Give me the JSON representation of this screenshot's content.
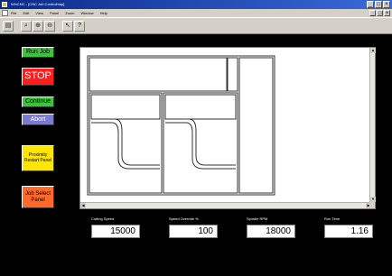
{
  "window": {
    "title": "WinCNC - [CNC Job Controlmap]",
    "controls": [
      "_",
      "□",
      "×"
    ]
  },
  "menubar": {
    "items": [
      "File",
      "Edit",
      "View",
      "Panel",
      "Zoom",
      "Window",
      "Help"
    ]
  },
  "toolbar": {
    "icons": [
      "open-icon",
      "zoom-icon",
      "zoom-in-icon",
      "zoom-out-icon",
      "pointer-icon",
      "help-icon"
    ],
    "glyphs": [
      "▤",
      "⌕",
      "⊕",
      "⊖",
      "↖",
      "?"
    ]
  },
  "buttons": {
    "run_job": "Run Job",
    "stop": "STOP",
    "continue": "Continue",
    "abort": "Abort",
    "proximity_restart": "Proximity Restart Panel",
    "job_select": "Job Select Panel"
  },
  "colors": {
    "run": "#3cc33c",
    "stop": "#ff1e1e",
    "continue": "#3cc33c",
    "abort": "#7b7bd4",
    "proximity": "#ffe600",
    "job_select": "#ff6a2a"
  },
  "readouts": [
    {
      "label": "Cutting Speed",
      "value": "15000"
    },
    {
      "label": "Speed Override %",
      "value": "100"
    },
    {
      "label": "Spindle RPM",
      "value": "18000"
    },
    {
      "label": "Run Time",
      "value": "1.16"
    }
  ]
}
